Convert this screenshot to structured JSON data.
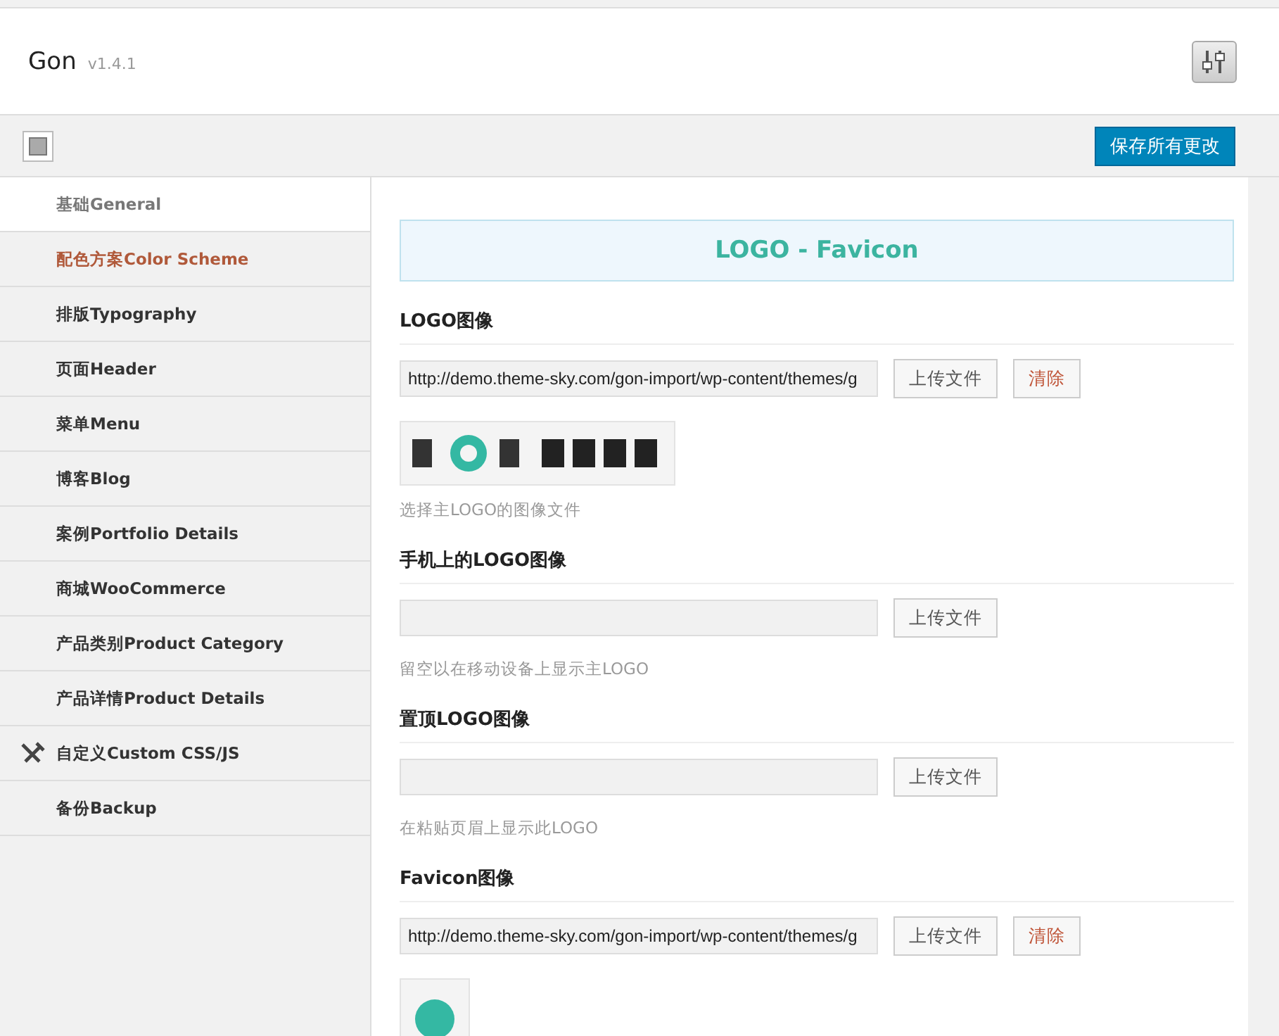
{
  "header": {
    "title": "Gon",
    "version": "v1.4.1"
  },
  "toolbar": {
    "save_button": "保存所有更改"
  },
  "sidebar": {
    "items": [
      {
        "label": "基础General",
        "selected": true,
        "highlighted": false,
        "kind": "plain"
      },
      {
        "label": "配色方案Color Scheme",
        "selected": false,
        "highlighted": true,
        "kind": "plain"
      },
      {
        "label": "排版Typography",
        "selected": false,
        "highlighted": false,
        "kind": "plain"
      },
      {
        "label": "页面Header",
        "selected": false,
        "highlighted": false,
        "kind": "plain"
      },
      {
        "label": "菜单Menu",
        "selected": false,
        "highlighted": false,
        "kind": "plain"
      },
      {
        "label": "博客Blog",
        "selected": false,
        "highlighted": false,
        "kind": "plain"
      },
      {
        "label": "案例Portfolio Details",
        "selected": false,
        "highlighted": false,
        "kind": "plain"
      },
      {
        "label": "商城WooCommerce",
        "selected": false,
        "highlighted": false,
        "kind": "plain"
      },
      {
        "label": "产品类别Product Category",
        "selected": false,
        "highlighted": false,
        "kind": "plain"
      },
      {
        "label": "产品详情Product Details",
        "selected": false,
        "highlighted": false,
        "kind": "plain"
      },
      {
        "label": "自定义Custom CSS/JS",
        "selected": false,
        "highlighted": false,
        "kind": "tools"
      },
      {
        "label": "备份Backup",
        "selected": false,
        "highlighted": false,
        "kind": "plain"
      }
    ]
  },
  "section": {
    "title": "LOGO - Favicon",
    "fields": [
      {
        "kind": "wide",
        "label": "LOGO图像",
        "value": "http://demo.theme-sky.com/gon-import/wp-content/themes/g",
        "upload": "上传文件",
        "remove": "清除",
        "hint": "选择主LOGO的图像文件"
      },
      {
        "label": "手机上的LOGO图像",
        "upload": "上传文件",
        "hint": "留空以在移动设备上显示主LOGO"
      },
      {
        "label": "置顶LOGO图像",
        "upload": "上传文件",
        "hint": "在粘贴页眉上显示此LOGO"
      },
      {
        "label": "Favicon图像",
        "value": "http://demo.theme-sky.com/gon-import/wp-content/themes/g",
        "upload": "上传文件",
        "remove": "清除",
        "kind": "square"
      }
    ]
  }
}
